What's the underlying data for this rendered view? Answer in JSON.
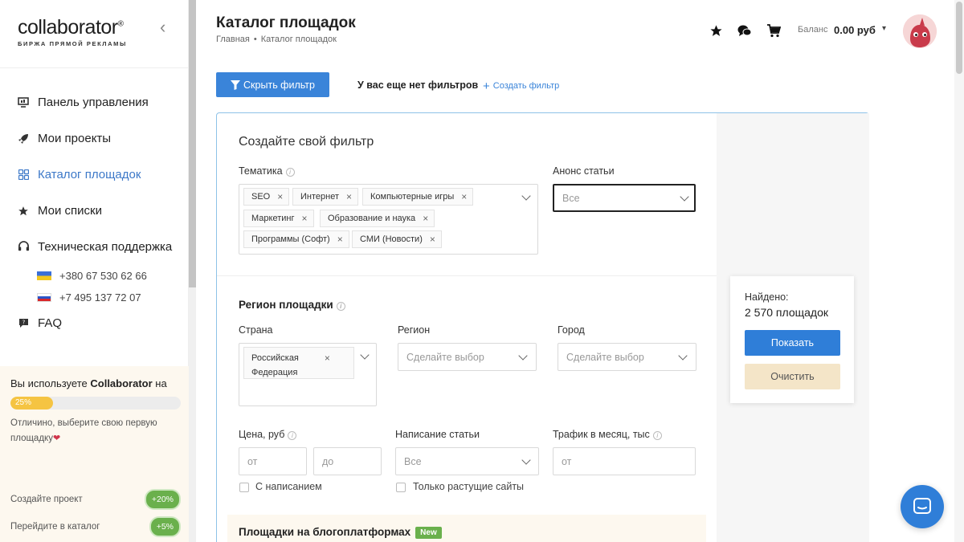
{
  "brand": {
    "name": "collaborator",
    "reg": "®",
    "tagline": "БИРЖА ПРЯМОЙ РЕКЛАМЫ"
  },
  "sidebar": {
    "items": [
      {
        "label": "Панель управления",
        "icon": "dashboard-icon"
      },
      {
        "label": "Мои проекты",
        "icon": "rocket-icon"
      },
      {
        "label": "Каталог площадок",
        "icon": "grid-icon",
        "active": true
      },
      {
        "label": "Мои списки",
        "icon": "star-icon"
      },
      {
        "label": "Техническая поддержка",
        "icon": "headset-icon"
      }
    ],
    "phones": [
      {
        "flag": "ua",
        "number": "+380 67 530 62 66"
      },
      {
        "flag": "ru",
        "number": "+7 495 137 72 07"
      }
    ],
    "faq": "FAQ",
    "progress": {
      "text_prefix": "Вы используете",
      "text_brand": "Collaborator",
      "text_suffix": "на",
      "percent_label": "25%",
      "percent": 25,
      "note": "Отличино, выберите свою первую площадку",
      "tasks": [
        {
          "label": "Создайте проект",
          "badge": "+20%"
        },
        {
          "label": "Перейдите в каталог",
          "badge": "+5%"
        }
      ]
    }
  },
  "header": {
    "title": "Каталог площадок",
    "breadcrumb": {
      "home": "Главная",
      "current": "Каталог площадок"
    },
    "balance_label": "Баланс",
    "balance_value": "0.00 руб",
    "caret": "▾"
  },
  "toolbar": {
    "hide_filter": "Скрыть фильтр",
    "no_filters": "У вас еще нет фильтров",
    "create_filter": "Создать фильтр"
  },
  "filter": {
    "title": "Создайте свой фильтр",
    "topic_label": "Тематика",
    "topics": [
      "SEO",
      "Интернет",
      "Компьютерные игры",
      "Маркетинг",
      "Образование и наука",
      "Программы (Софт)",
      "СМИ (Новости)"
    ],
    "announce_label": "Анонс статьи",
    "announce_value": "Все",
    "region_title": "Регион площадки",
    "country_label": "Страна",
    "country_chip_line1": "Российская",
    "country_chip_line2": "Федерация",
    "region_label": "Регион",
    "region_placeholder": "Сделайте выбор",
    "city_label": "Город",
    "city_placeholder": "Сделайте выбор",
    "price_label": "Цена, руб",
    "price_from": "от",
    "price_to": "до",
    "writing_label": "Написание статьи",
    "writing_value": "Все",
    "traffic_label": "Трафик в месяц, тыс",
    "traffic_from": "от",
    "with_writing": "С написанием",
    "growing_only": "Только растущие сайты",
    "blog_title": "Площадки на блогоплатформах",
    "new_badge": "New"
  },
  "result": {
    "found_label": "Найдено:",
    "found_value": "2 570 площадок",
    "show": "Показать",
    "clear": "Очистить"
  },
  "colors": {
    "accent": "#3a84d9",
    "active_nav": "#3c78c8",
    "progress": "#f5c442",
    "badge_green": "#6ab04c"
  }
}
